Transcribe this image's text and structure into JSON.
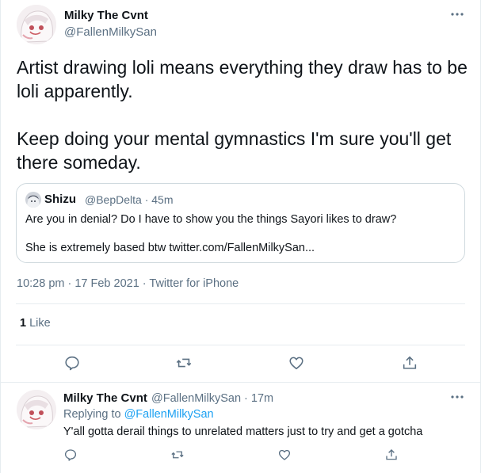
{
  "main_tweet": {
    "author_name": "Milky The Cvnt",
    "author_handle": "@FallenMilkySan",
    "text": "Artist drawing loli means everything they draw has to be loli apparently.\n\nKeep doing your mental gymnastics I'm sure you'll get there someday.",
    "timestamp": "10:28 pm · 17 Feb 2021 · Twitter for iPhone",
    "likes_count": "1",
    "likes_label": "Like"
  },
  "quoted_tweet": {
    "author_name": "Shizu",
    "meta": "@BepDelta · 45m",
    "line1": "Are you in denial? Do I have to show you the things Sayori likes to draw?",
    "line2": "She is extremely based btw twitter.com/FallenMilkySan..."
  },
  "reply_tweet": {
    "author_name": "Milky The Cvnt",
    "meta": "@FallenMilkySan · 17m",
    "replying_prefix": "Replying to",
    "replying_handle": "@FallenMilkySan",
    "text": "Y'all gotta derail things to unrelated matters just to try and get a gotcha"
  },
  "icons": {
    "more": "more-horizontal-icon",
    "reply": "reply-bubble-icon",
    "retweet": "retweet-icon",
    "like": "heart-icon",
    "share": "share-icon"
  },
  "colors": {
    "text": "#0f1419",
    "secondary": "#5b7083",
    "link": "#1da1f2",
    "border": "#e6ecf0"
  }
}
